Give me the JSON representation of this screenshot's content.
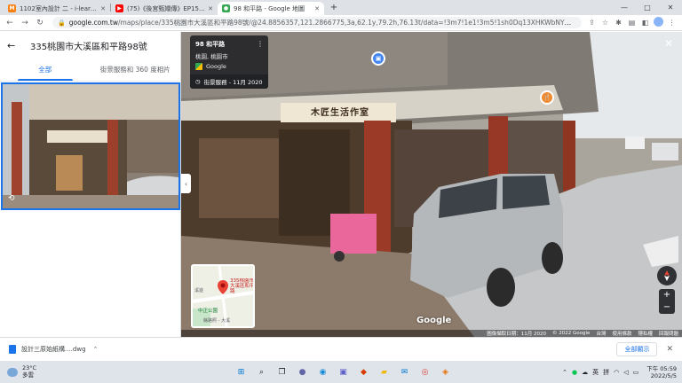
{
  "browser": {
    "tabs": [
      {
        "title": "1102室內設計 二 - i-learning平台",
        "icon": "moodle-icon",
        "color": "#f98012",
        "active": false
      },
      {
        "title": "(75)《後宮甄嬛傳》EP15 - 李佳...",
        "icon": "youtube-icon",
        "color": "#ff0000",
        "active": false
      },
      {
        "title": "98 和平路 - Google 地圖",
        "icon": "maps-pin-icon",
        "color": "#34a853",
        "active": true
      }
    ],
    "new_tab": "+",
    "url_host": "google.com.tw",
    "url_path": "/maps/place/335桃園市大溪區和平路98號/@24.8856357,121.2866775,3a,62.1y,79.2h,76.13t/data=!3m7!1e1!3m5!1sh0Dq13XHKWbNYME-vTkj7g!2e0!6shttps:...",
    "window_controls": [
      "—",
      "□",
      "✕"
    ]
  },
  "panel": {
    "back_icon": "arrow-back-icon",
    "title": "335桃園市大溪區和平路98號",
    "tabs": [
      {
        "label": "全部",
        "active": true
      },
      {
        "label": "街景服務和 360 度相片",
        "active": false
      }
    ]
  },
  "streetview": {
    "card_address": "98 和平路",
    "card_city": "桃園, 桃園市",
    "card_brand": "Google",
    "date_label": "街景服務 - 11月 2020",
    "shop_sign": "木匠生活作室",
    "minimap_label_1": "335桃園市大溪區和平路",
    "minimap_label_2": "中正公園",
    "minimap_label_3": "縣路照 - 大溪",
    "minimap_label_4": "溪遊",
    "google_logo": "Google",
    "footer": [
      "圖像擷取日期：11月 2020",
      "© 2022 Google",
      "台灣",
      "使用條款",
      "隱私權",
      "回報問題"
    ],
    "zoom_in": "+",
    "zoom_out": "−"
  },
  "downloads": {
    "file_name": "設計三原始紙構....dwg",
    "show_all": "全部顯示"
  },
  "taskbar": {
    "temp": "23°C",
    "weather": "多雲",
    "ime_1": "英",
    "ime_2": "拼",
    "time": "下午 05:59",
    "date": "2022/5/5"
  }
}
